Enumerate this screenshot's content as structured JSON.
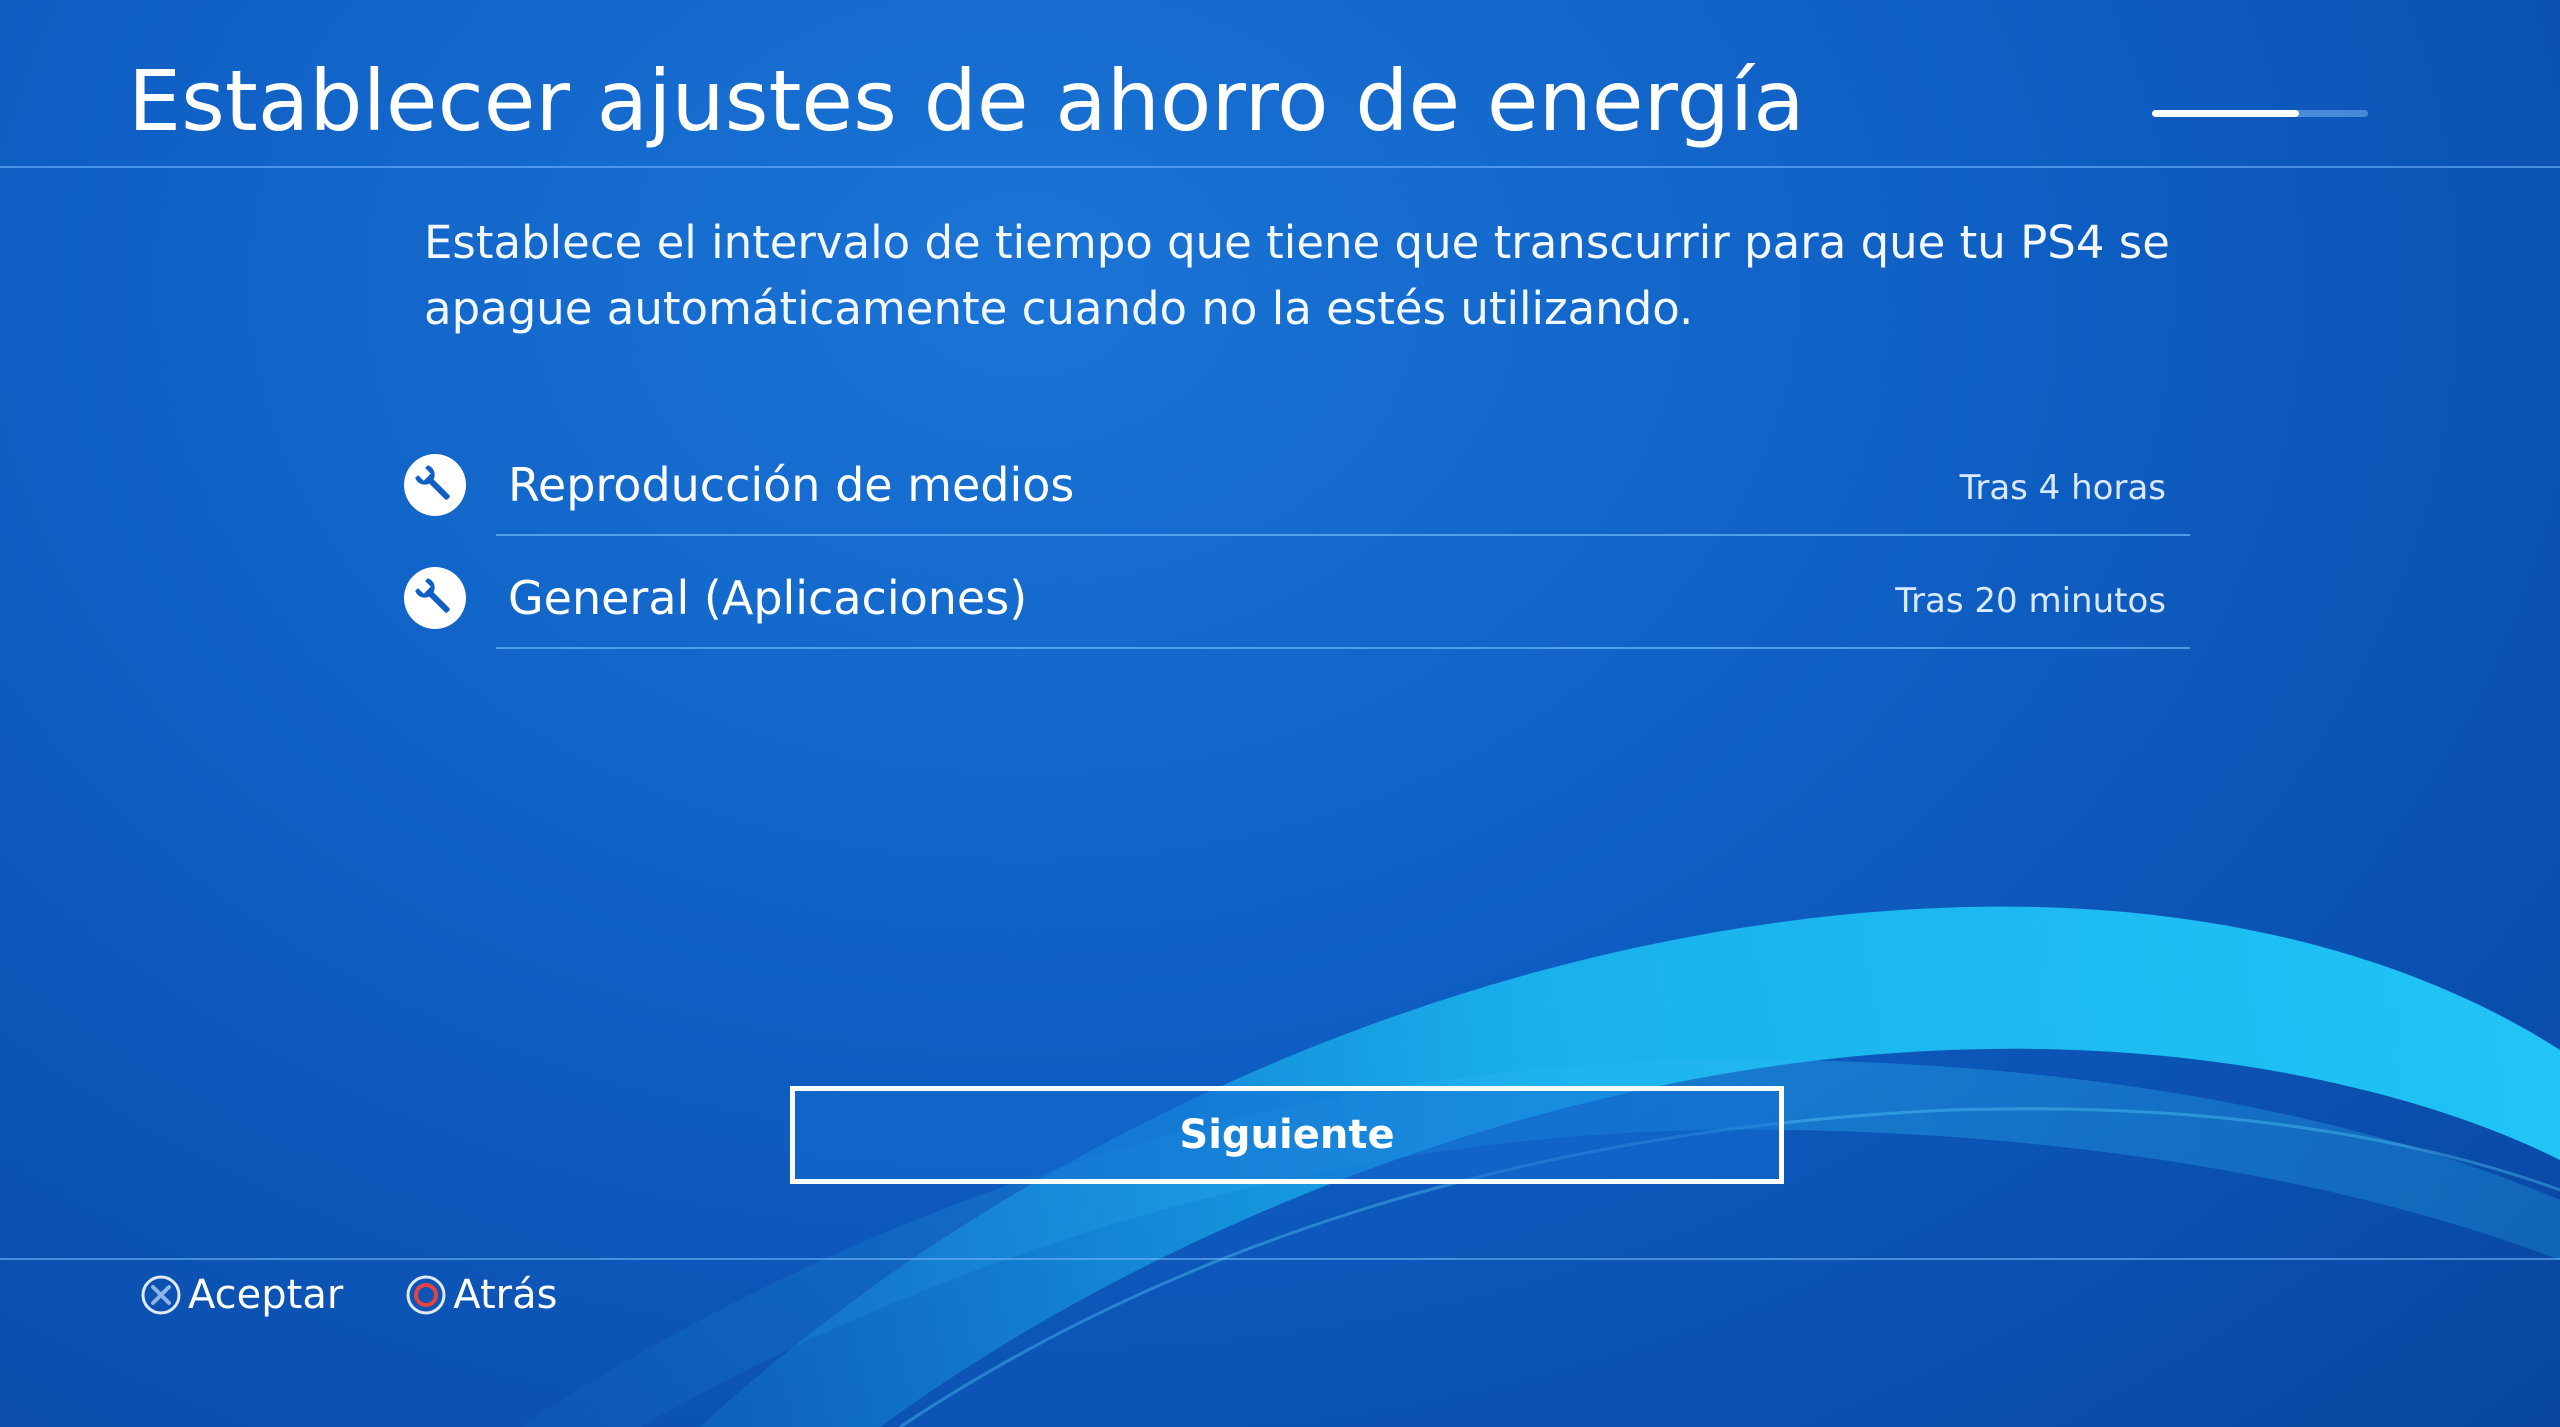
{
  "header": {
    "title": "Establecer ajustes de ahorro de energía",
    "step_progress": 0.68
  },
  "description": "Establece el intervalo de tiempo que tiene que transcurrir para que tu PS4 se apague automáticamente cuando no la estés utilizando.",
  "settings": [
    {
      "icon": "wrench-icon",
      "label": "Reproducción de medios",
      "value": "Tras 4 horas"
    },
    {
      "icon": "wrench-icon",
      "label": "General (Aplicaciones)",
      "value": "Tras 20 minutos"
    }
  ],
  "actions": {
    "next_label": "Siguiente"
  },
  "footer": {
    "accept": {
      "icon": "cross-button-icon",
      "label": "Aceptar"
    },
    "back": {
      "icon": "circle-button-icon",
      "label": "Atrás"
    }
  },
  "colors": {
    "background": "#0f5fc4",
    "accent_wave": "#19c3f5",
    "circle_button": "#e8423f"
  }
}
